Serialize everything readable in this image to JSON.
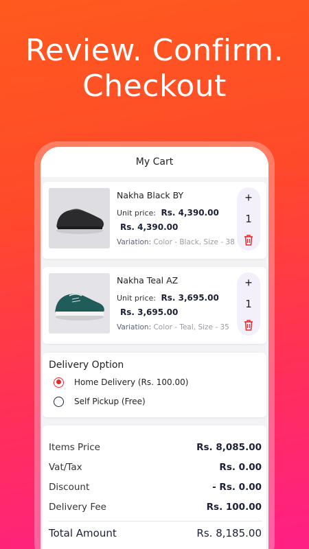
{
  "headline": {
    "line1": "Review. Confirm.",
    "line2": "Checkout"
  },
  "cart": {
    "title": "My Cart",
    "items": [
      {
        "name": "Nakha Black BY",
        "unit_price_label": "Unit price:",
        "unit_price": "Rs. 4,390.00",
        "total": "Rs. 4,390.00",
        "variation_label": "Variation:",
        "variation_value": "Color - Black,  Size - 38",
        "quantity": "1",
        "plus": "+",
        "shoe_color": "#2b2b2e"
      },
      {
        "name": "Nakha Teal AZ",
        "unit_price_label": "Unit price:",
        "unit_price": "Rs. 3,695.00",
        "total": "Rs. 3,695.00",
        "variation_label": "Variation:",
        "variation_value": "Color - Teal,  Size - 35",
        "quantity": "1",
        "plus": "+",
        "shoe_color": "#1f5c5a"
      }
    ]
  },
  "delivery": {
    "title": "Delivery Option",
    "options": [
      {
        "label": "Home Delivery (Rs. 100.00)",
        "selected": true
      },
      {
        "label": "Self Pickup (Free)",
        "selected": false
      }
    ]
  },
  "summary": {
    "rows": [
      {
        "label": "Items Price",
        "value": "Rs. 8,085.00"
      },
      {
        "label": "Vat/Tax",
        "value": "Rs. 0.00"
      },
      {
        "label": "Discount",
        "value": "- Rs. 0.00"
      },
      {
        "label": "Delivery Fee",
        "value": "Rs. 100.00"
      }
    ],
    "total_label": "Total Amount",
    "total_value": "Rs. 8,185.00"
  },
  "colors": {
    "accent": "#e8272a",
    "stepper_bg": "#f4f0fb",
    "navy": "#1b2036"
  }
}
